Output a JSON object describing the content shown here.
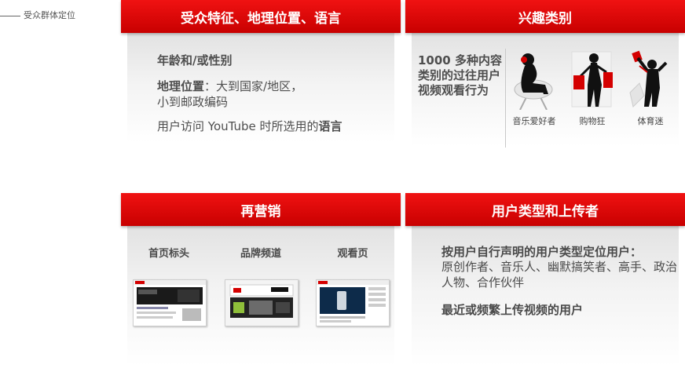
{
  "section_label": "受众群体定位",
  "cards": {
    "demographics": {
      "title": "受众特征、地理位置、语言",
      "age_gender": "年龄和/或性别",
      "geo_label": "地理位置",
      "geo_text_1": "：大到国家/地区，",
      "geo_text_2": "小到邮政编码",
      "lang_prefix": "用户访问 YouTube 时所选用的",
      "lang_bold": "语言"
    },
    "interests": {
      "title": "兴趣类别",
      "lead": "1000 多种内容类别的过往用户视频观看行为",
      "categories": [
        {
          "label": "音乐爱好者",
          "icon": "music-lover-silhouette-icon"
        },
        {
          "label": "购物狂",
          "icon": "shopper-silhouette-icon"
        },
        {
          "label": "体育迷",
          "icon": "sports-fan-silhouette-icon"
        }
      ]
    },
    "remarketing": {
      "title": "再营销",
      "tabs": [
        "首页标头",
        "品牌频道",
        "观看页"
      ]
    },
    "user_types": {
      "title": "用户类型和上传者",
      "line1": "按用户自行声明的用户类型定位用户：",
      "line2": "原创作者、音乐人、幽默搞笑者、高手、政治人物、合作伙伴",
      "line3": "最近或频繁上传视频的用户"
    }
  },
  "colors": {
    "header_red": "#e00000",
    "text_gray": "#4a4a4a"
  }
}
